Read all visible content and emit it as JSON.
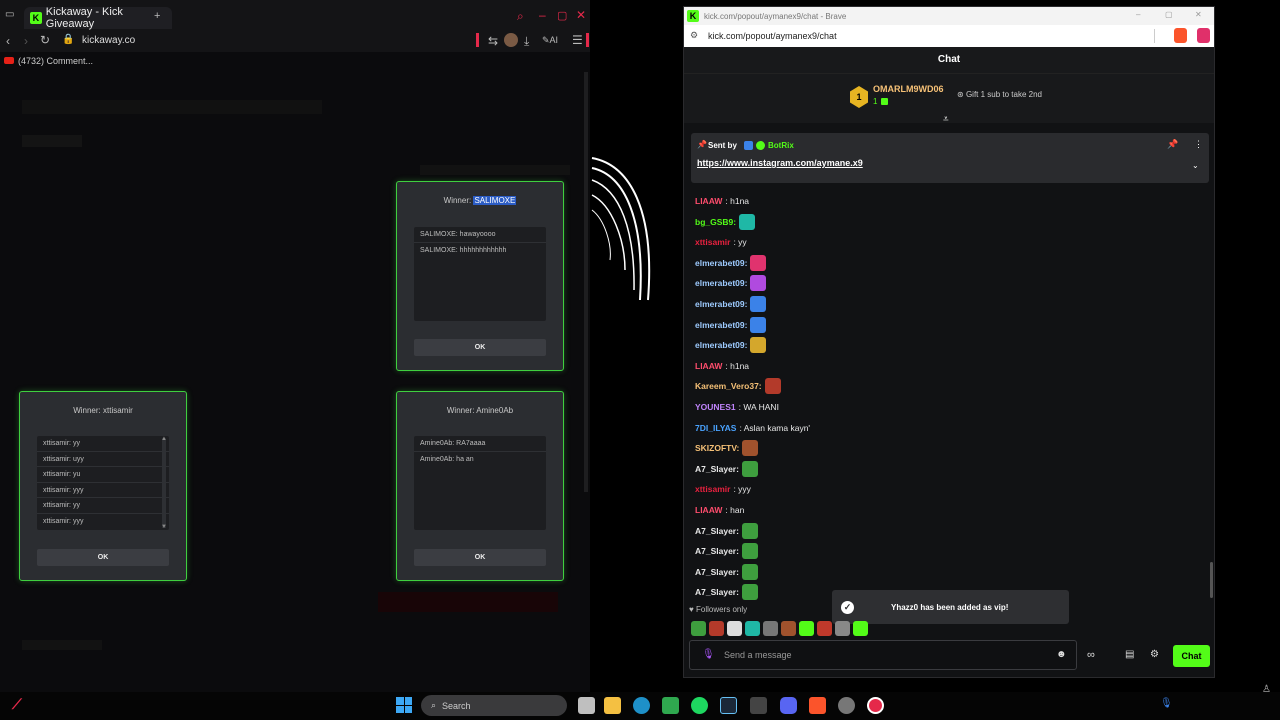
{
  "left_browser": {
    "tab_title": "Kickaway - Kick Giveaway",
    "url": "kickaway.co",
    "bookmark": "(4732) Comment...",
    "ai_label": "AI"
  },
  "giveaway_modals": [
    {
      "winner_label": "Winner:",
      "winner_name": "SALIMOXE",
      "messages": [
        "SALIMOXE: hawayoooo",
        "SALIMOXE: hhhhhhhhhhhh"
      ],
      "ok_label": "OK"
    },
    {
      "winner_label": "Winner:",
      "winner_name": "xttisamir",
      "messages": [
        "xttisamir: yy",
        "xttisamir: uyy",
        "xttisamir: yu",
        "xttisamir: yyy",
        "xttisamir: yy",
        "xttisamir: yyy"
      ],
      "ok_label": "OK"
    },
    {
      "winner_label": "Winner:",
      "winner_name": "Amine0Ab",
      "messages": [
        "Amine0Ab: RA7aaaa",
        "Amine0Ab: ha an"
      ],
      "ok_label": "OK"
    }
  ],
  "right_browser": {
    "window_title": "kick.com/popout/aymanex9/chat - Brave",
    "url": "kick.com/popout/aymanex9/chat",
    "chat_header": "Chat",
    "leaderboard": {
      "rank": "1",
      "name": "OMARLM9WD06",
      "count": "1",
      "gift_prompt": "Gift 1 sub to take 2nd"
    },
    "pinned": {
      "sent_by_label": "Sent by",
      "sender": "BotRix",
      "link": "https://www.instagram.com/aymane.x9"
    },
    "messages": [
      {
        "user": "LIAAW",
        "color": "#ff4d6d",
        "text": ": h1na",
        "emote": ""
      },
      {
        "user": "bg_GSB9:",
        "color": "#53fc18",
        "text": "",
        "emote": "#1fb8a6"
      },
      {
        "user": "xttisamir",
        "color": "#e8213f",
        "text": ": yy",
        "emote": ""
      },
      {
        "user": "elmerabet09:",
        "color": "#9ecbff",
        "text": "",
        "emote": "#e0336e"
      },
      {
        "user": "elmerabet09:",
        "color": "#9ecbff",
        "text": "",
        "emote": "#b04adf"
      },
      {
        "user": "elmerabet09:",
        "color": "#9ecbff",
        "text": "",
        "emote": "#3b82e8"
      },
      {
        "user": "elmerabet09:",
        "color": "#9ecbff",
        "text": "",
        "emote": "#3b82e8"
      },
      {
        "user": "elmerabet09:",
        "color": "#9ecbff",
        "text": "",
        "emote": "#d4a72c"
      },
      {
        "user": "LIAAW",
        "color": "#ff4d6d",
        "text": ": h1na",
        "emote": ""
      },
      {
        "user": "Kareem_Vero37:",
        "color": "#f6c177",
        "text": "",
        "emote": "#b33a2a"
      },
      {
        "user": "YOUNES1",
        "color": "#c084fc",
        "text": ": WA HANI",
        "emote": ""
      },
      {
        "user": "7DI_ILYAS",
        "color": "#4aa3ff",
        "text": ": Aslan kama kayn'",
        "emote": ""
      },
      {
        "user": "SKIZOFTV:",
        "color": "#f6c177",
        "text": "",
        "emote": "#a0522d"
      },
      {
        "user": "A7_Slayer:",
        "color": "#e8e8e8",
        "text": "",
        "emote": "#3e9e3e"
      },
      {
        "user": "xttisamir",
        "color": "#e8213f",
        "text": ": yyy",
        "emote": ""
      },
      {
        "user": "LIAAW",
        "color": "#ff4d6d",
        "text": ": han",
        "emote": ""
      },
      {
        "user": "A7_Slayer:",
        "color": "#e8e8e8",
        "text": "",
        "emote": "#3e9e3e"
      },
      {
        "user": "A7_Slayer:",
        "color": "#e8e8e8",
        "text": "",
        "emote": "#3e9e3e"
      },
      {
        "user": "A7_Slayer:",
        "color": "#e8e8e8",
        "text": "",
        "emote": "#3e9e3e"
      },
      {
        "user": "A7_Slayer:",
        "color": "#e8e8e8",
        "text": "",
        "emote": "#3e9e3e"
      }
    ],
    "toast": "Yhazz0 has been added as vip!",
    "followers_only": "Followers only",
    "input_placeholder": "Send a message",
    "chat_button": "Chat"
  },
  "taskbar": {
    "search_label": "Search"
  },
  "colors": {
    "kick_green": "#53fc18",
    "modal_border": "#3fcf3f",
    "opera_red": "#e5294a"
  }
}
